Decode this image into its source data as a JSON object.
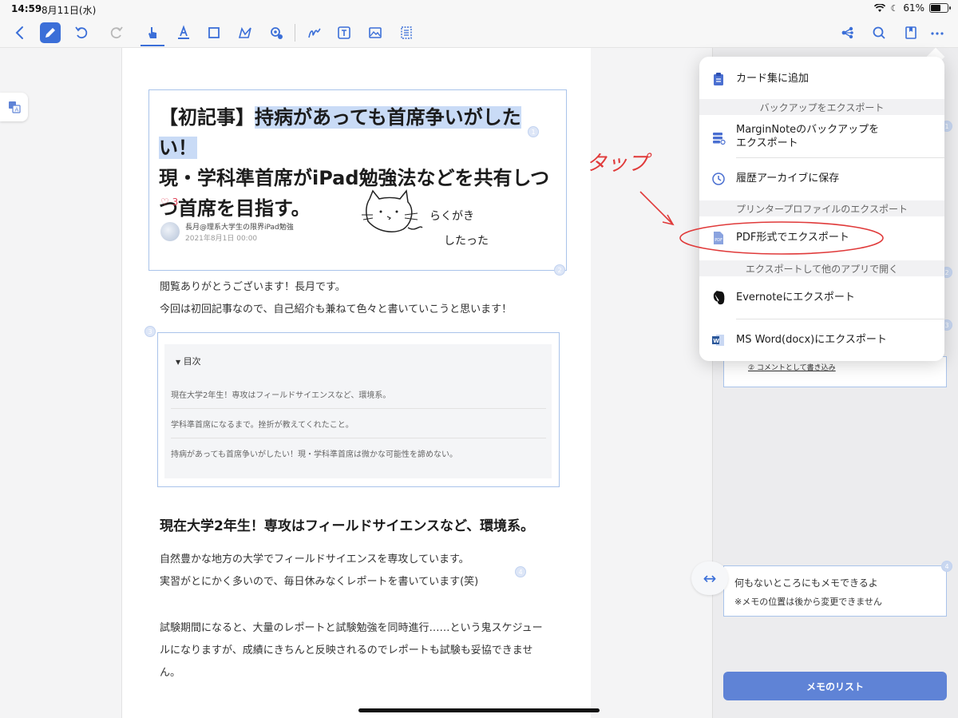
{
  "status_bar": {
    "time": "14:59",
    "date": "8月11日(水)",
    "battery": "61%",
    "battery_level": 0.61
  },
  "toolbar": {
    "icons": [
      "back-icon",
      "pen-icon",
      "undo-icon",
      "redo-icon",
      "hand-pointer-icon",
      "text-highlight-icon",
      "rectangle-select-icon",
      "lasso-icon",
      "settings-badge-icon",
      "scribble-icon",
      "text-box-icon",
      "image-icon",
      "list-select-icon",
      "mindmap-share-icon",
      "search-icon",
      "bookmark-icon",
      "more-icon"
    ],
    "accent": "#3b6fd8"
  },
  "document": {
    "title_highlight_prefix": "【初記事】",
    "title_highlight": "持病があっても首席争いがしたい！",
    "title_rest": "現・学科準首席がiPad勉強法などを共有しつつ首席を目指す。",
    "likes": "3",
    "author": "長月@理系大学生の限界iPad勉強",
    "published": "2021年8月1日 00:00",
    "doodle_line1": "らくがき",
    "doodle_line2": "したった",
    "intro1": "閲覧ありがとうございます！長月です。",
    "intro2": "今回は初回記事なので、自己紹介も兼ねて色々と書いていこうと思います！",
    "toc_label": "目次",
    "toc_items": [
      "現在大学2年生！専攻はフィールドサイエンスなど、環境系。",
      "学科準首席になるまで。挫折が教えてくれたこと。",
      "持病があっても首席争いがしたい！現・学科準首席は微かな可能性を諦めない。"
    ],
    "section_heading": "現在大学2年生！専攻はフィールドサイエンスなど、環境系。",
    "para1_line1": "自然豊かな地方の大学でフィールドサイエンスを専攻しています。",
    "para1_line2": "実習がとにかく多いので、毎日休みなくレポートを書いています(笑)",
    "para2_line1": "試験期間になると、大量のレポートと試験勉強を同時進行……という鬼スケジュー",
    "para2_line2": "ルになりますが、成績にきちんと反映されるのでレポートも試験も妥協できませ",
    "para2_line3": "ん。",
    "badges": [
      "1",
      "2",
      "3",
      "4"
    ]
  },
  "menu": {
    "add_to_card": "カード集に追加",
    "section_backup": "バックアップをエクスポート",
    "marginnote_backup_line1": "MarginNoteのバックアップを",
    "marginnote_backup_line2": "エクスポート",
    "save_history": "履歴アーカイブに保存",
    "section_printer": "プリンタープロファイルのエクスポート",
    "export_pdf": "PDF形式でエクスポート",
    "section_other_app": "エクスポートして他のアプリで開く",
    "export_evernote": "Evernoteにエクスポート",
    "export_word": "MS Word(docx)にエクスポート"
  },
  "side_panel": {
    "memo_partial": "② コメントとして書き込み",
    "memo4_line1": "何もないところにもメモできるよ",
    "memo4_line2": "※メモの位置は後から変更できません",
    "memo_list_button": "メモのリスト",
    "badges": [
      "1",
      "2",
      "3",
      "4"
    ]
  },
  "annotation": {
    "handwritten_tap": "タップ",
    "color": "#e03a3a"
  }
}
